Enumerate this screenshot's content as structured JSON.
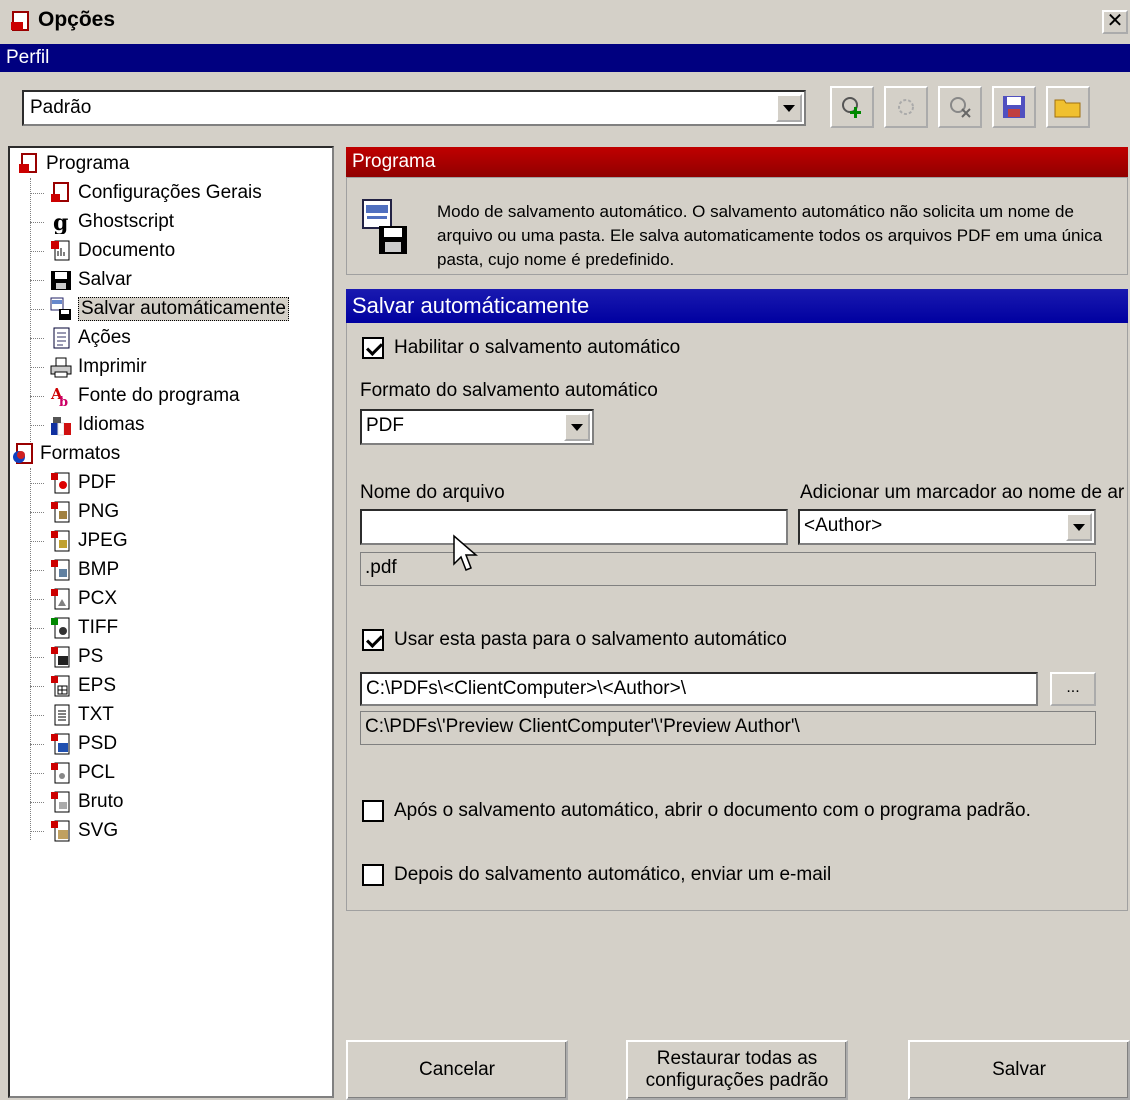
{
  "window": {
    "title": "Opções"
  },
  "profile": {
    "header": "Perfil",
    "selected": "Padrão"
  },
  "tree": {
    "groups": [
      {
        "label": "Programa",
        "icon": "programa-icon",
        "items": [
          {
            "label": "Configurações Gerais",
            "icon": "config-icon"
          },
          {
            "label": "Ghostscript",
            "icon": "ghostscript-icon"
          },
          {
            "label": "Documento",
            "icon": "documento-icon"
          },
          {
            "label": "Salvar",
            "icon": "salvar-icon"
          },
          {
            "label": "Salvar automáticamente",
            "icon": "auto-save-icon",
            "selected": true
          },
          {
            "label": "Ações",
            "icon": "acoes-icon"
          },
          {
            "label": "Imprimir",
            "icon": "printer-icon"
          },
          {
            "label": "Fonte do programa",
            "icon": "font-icon"
          },
          {
            "label": "Idiomas",
            "icon": "flag-icon"
          }
        ]
      },
      {
        "label": "Formatos",
        "icon": "formatos-icon",
        "items": [
          {
            "label": "PDF"
          },
          {
            "label": "PNG"
          },
          {
            "label": "JPEG"
          },
          {
            "label": "BMP"
          },
          {
            "label": "PCX"
          },
          {
            "label": "TIFF"
          },
          {
            "label": "PS"
          },
          {
            "label": "EPS"
          },
          {
            "label": "TXT"
          },
          {
            "label": "PSD"
          },
          {
            "label": "PCL"
          },
          {
            "label": "Bruto"
          },
          {
            "label": "SVG"
          }
        ]
      }
    ]
  },
  "section": {
    "title": "Programa",
    "description": "Modo de salvamento automático. O salvamento automático não solicita um nome de arquivo ou uma pasta. Ele salva automaticamente todos os arquivos PDF em uma única pasta, cujo nome é predefinido."
  },
  "autosave": {
    "title": "Salvar automáticamente",
    "enable_label": "Habilitar o salvamento automático",
    "enable_checked": true,
    "format_label": "Formato do salvamento automático",
    "format_value": "PDF",
    "filename_label": "Nome do arquivo",
    "filename_value": "",
    "marker_label": "Adicionar um marcador ao nome de ar",
    "marker_value": "<Author>",
    "filename_preview": ".pdf",
    "folder_label": "Usar esta pasta para o salvamento automático",
    "folder_checked": true,
    "folder_value": "C:\\PDFs\\<ClientComputer>\\<Author>\\",
    "browse_label": "...",
    "folder_preview": "C:\\PDFs\\'Preview ClientComputer'\\'Preview Author'\\",
    "open_after_label": "Após o salvamento automático, abrir o documento com o programa padrão.",
    "open_after_checked": false,
    "email_label": "Depois do salvamento automático, enviar um e-mail",
    "email_checked": false
  },
  "buttons": {
    "cancel": "Cancelar",
    "restore_line1": "Restaurar todas as",
    "restore_line2": "configurações padrão",
    "save": "Salvar"
  },
  "colors": {
    "title_bar_blue": "#000080",
    "section_red": "#b00000",
    "section_blue": "#0000a0",
    "face": "#d4d0c8"
  }
}
